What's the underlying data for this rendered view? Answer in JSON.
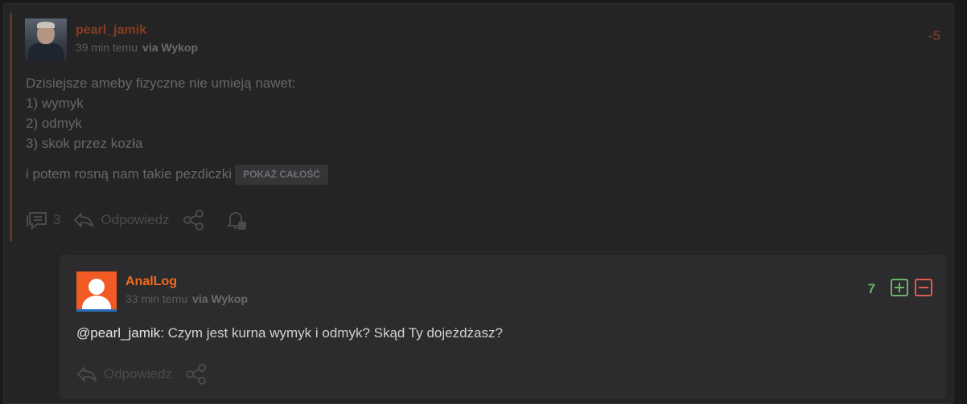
{
  "post": {
    "author": "pearl_jamik",
    "author_color": "#8a3b1f",
    "time": "39 min temu",
    "via": "via Wykop",
    "score": "-5",
    "lines": [
      "Dzisiejsze ameby fizyczne nie umieją nawet:",
      "1) wymyk",
      "2) odmyk",
      "3) skok przez kozła"
    ],
    "last_line": "i potem rosną nam takie pezdiczki",
    "show_more": "POKAŻ CAŁOŚĆ",
    "comments_count": "3",
    "reply_label": "Odpowiedz",
    "icons": [
      "comments-icon",
      "reply-icon",
      "share-icon",
      "notify-icon"
    ]
  },
  "reply": {
    "author": "AnalLog",
    "author_color": "#f26a1b",
    "time": "33 min temu",
    "via": "via Wykop",
    "score": "7",
    "mention": "@pearl_jamik",
    "text": ": Czym jest kurna wymyk i odmyk? Skąd Ty dojeżdżasz?",
    "reply_label": "Odpowiedz",
    "vote_up_color": "#6bb36a",
    "vote_down_color": "#e3594d",
    "icons": [
      "upvote-icon",
      "downvote-icon",
      "reply-icon",
      "share-icon"
    ]
  }
}
